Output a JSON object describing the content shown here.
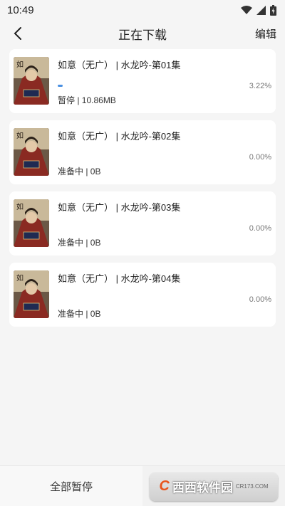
{
  "status_bar": {
    "time": "10:49"
  },
  "nav": {
    "title": "正在下载",
    "edit_label": "编辑"
  },
  "downloads": [
    {
      "title": "如意（无广） | 水龙吟-第01集",
      "status": "暂停 | 10.86MB",
      "percent": "3.22%",
      "progress": 0.0322
    },
    {
      "title": "如意（无广） | 水龙吟-第02集",
      "status": "准备中 | 0B",
      "percent": "0.00%",
      "progress": 0
    },
    {
      "title": "如意（无广） | 水龙吟-第03集",
      "status": "准备中 | 0B",
      "percent": "0.00%",
      "progress": 0
    },
    {
      "title": "如意（无广） | 水龙吟-第04集",
      "status": "准备中 | 0B",
      "percent": "0.00%",
      "progress": 0
    }
  ],
  "bottom": {
    "pause_all_label": "全部暂停"
  },
  "watermark": {
    "brand": "西西软件园",
    "url": "CR173.COM"
  },
  "colors": {
    "accent": "#4a90e2",
    "card_bg": "#ffffff",
    "page_bg": "#f5f5f5"
  }
}
